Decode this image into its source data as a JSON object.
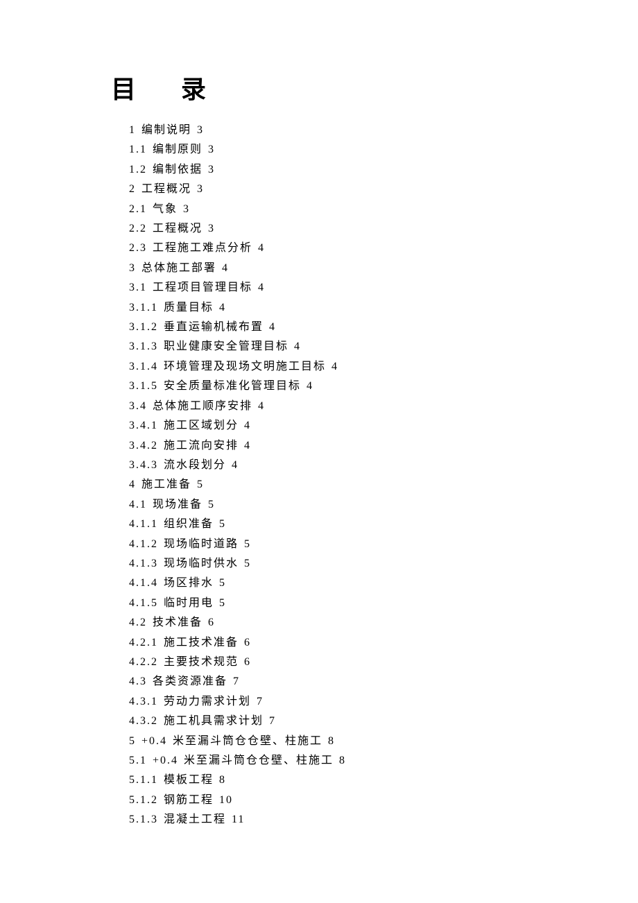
{
  "title": "目 录",
  "toc": [
    {
      "text": "1 编制说明 3"
    },
    {
      "text": "1.1 编制原则 3"
    },
    {
      "text": "1.2 编制依据 3"
    },
    {
      "text": "2  工程概况 3"
    },
    {
      "text": "2.1 气象 3"
    },
    {
      "text": "2.2 工程概况 3"
    },
    {
      "text": "2.3 工程施工难点分析 4"
    },
    {
      "text": "3 总体施工部署 4"
    },
    {
      "text": "3.1 工程项目管理目标 4"
    },
    {
      "text": "3.1.1  质量目标 4"
    },
    {
      "text": "3.1.2 垂直运输机械布置 4"
    },
    {
      "text": "3.1.3  职业健康安全管理目标 4"
    },
    {
      "text": "3.1.4  环境管理及现场文明施工目标 4"
    },
    {
      "text": "3.1.5  安全质量标准化管理目标 4"
    },
    {
      "text": "3.4  总体施工顺序安排 4"
    },
    {
      "text": "3.4.1  施工区域划分 4"
    },
    {
      "text": "3.4.2  施工流向安排 4"
    },
    {
      "text": "3.4.3 流水段划分 4"
    },
    {
      "text": "4 施工准备 5"
    },
    {
      "text": "4.1  现场准备 5"
    },
    {
      "text": "4.1.1  组织准备 5"
    },
    {
      "text": "4.1.2  现场临时道路 5"
    },
    {
      "text": "4.1.3  现场临时供水 5"
    },
    {
      "text": "4.1.4  场区排水 5"
    },
    {
      "text": "4.1.5  临时用电 5"
    },
    {
      "text": "4.2 技术准备 6"
    },
    {
      "text": "4.2.1  施工技术准备 6"
    },
    {
      "text": "4.2.2  主要技术规范 6"
    },
    {
      "text": "4.3 各类资源准备 7"
    },
    {
      "text": "4.3.1  劳动力需求计划 7"
    },
    {
      "text": "4.3.2  施工机具需求计划 7"
    },
    {
      "text": "5 +0.4 米至漏斗筒仓仓壁、柱施工 8"
    },
    {
      "text": "5.1  +0.4 米至漏斗筒仓仓壁、柱施工 8"
    },
    {
      "text": "5.1.1 模板工程 8"
    },
    {
      "text": "5.1.2 钢筋工程 10"
    },
    {
      "text": "5.1.3 混凝土工程 11"
    }
  ]
}
